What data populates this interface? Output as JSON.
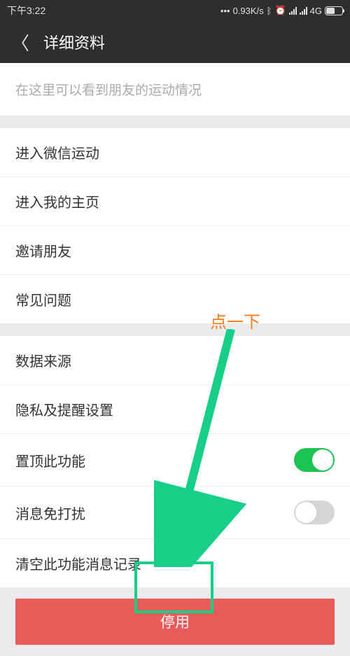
{
  "status": {
    "time": "下午3:22",
    "speed": "0.93K/s",
    "network": "4G"
  },
  "header": {
    "title": "详细资料"
  },
  "info": {
    "description": "在这里可以看到朋友的运动情况"
  },
  "section1": {
    "items": [
      "进入微信运动",
      "进入我的主页",
      "邀请朋友",
      "常见问题"
    ]
  },
  "section2": {
    "items": [
      {
        "label": "数据来源",
        "toggle": null
      },
      {
        "label": "隐私及提醒设置",
        "toggle": null
      },
      {
        "label": "置顶此功能",
        "toggle": true
      },
      {
        "label": "消息免打扰",
        "toggle": false
      },
      {
        "label": "清空此功能消息记录",
        "toggle": null
      }
    ]
  },
  "button": {
    "disable": "停用"
  },
  "annotation": {
    "label": "点一下"
  }
}
